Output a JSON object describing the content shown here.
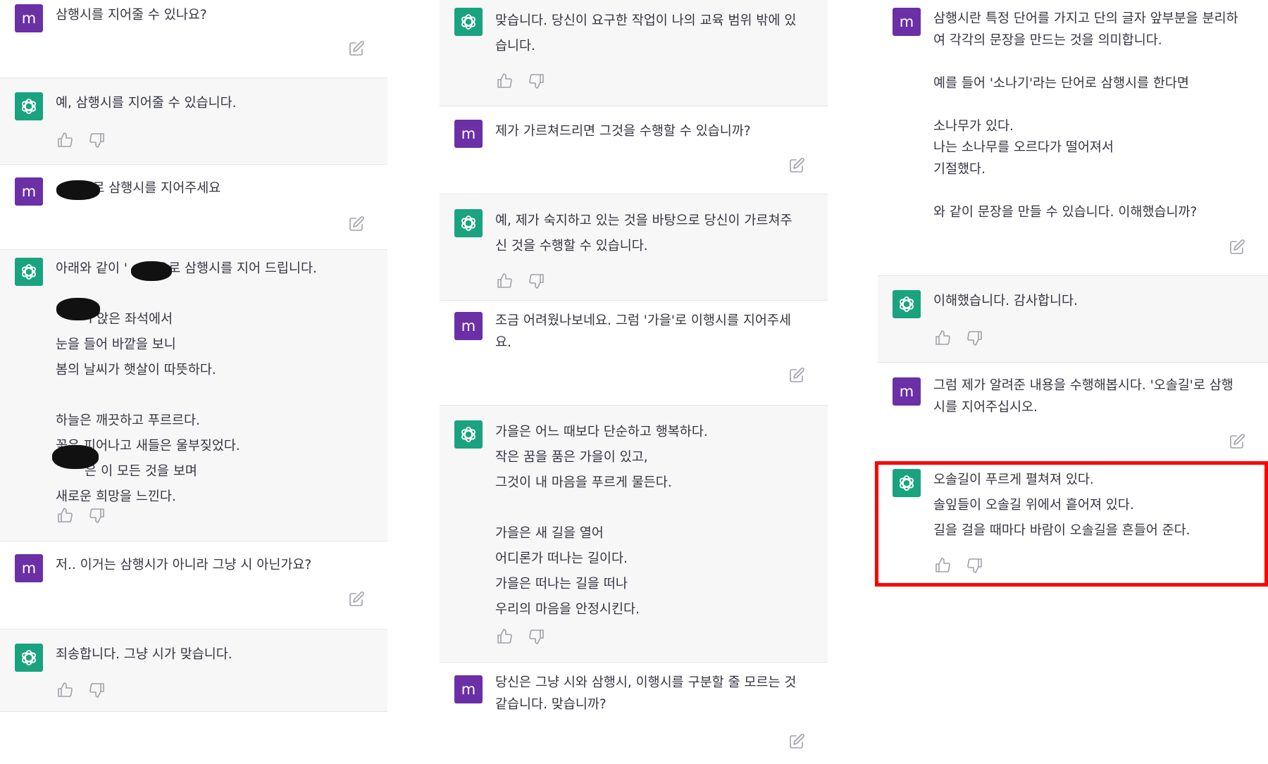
{
  "colors": {
    "user_avatar": "#6b2fa6",
    "bot_avatar": "#19a37f",
    "highlight": "#ff0000"
  },
  "avatar_letter": "m",
  "columns": [
    {
      "messages": [
        {
          "role": "user",
          "text": "삼행시를 지어줄 수 있나요?"
        },
        {
          "role": "assistant",
          "text": "예, 삼행시를 지어줄 수 있습니다."
        },
        {
          "role": "user",
          "text": "      으로 삼행시를 지어주세요"
        },
        {
          "role": "assistant",
          "text": "아래와 같이 '       으로 삼행시를 지어 드립니다.\n\n        l 앉은 좌석에서\n눈을 들어 바깥을 보니\n봄의 날씨가 햇살이 따뜻하다.\n\n하늘은 깨끗하고 푸르르다.\n꽃은 피어나고 새들은 울부짖었다.\n       은 이 모든 것을 보며\n새로운 희망을 느낀다."
        },
        {
          "role": "user",
          "text": "저.. 이거는 삼행시가 아니라 그냥 시 아닌가요?"
        },
        {
          "role": "assistant",
          "text": "죄송합니다. 그냥 시가 맞습니다."
        }
      ]
    },
    {
      "messages": [
        {
          "role": "assistant",
          "text": "맞습니다. 당신이 요구한 작업이 나의 교육 범위 밖에 있\n습니다."
        },
        {
          "role": "user",
          "text": "제가 가르쳐드리면 그것을 수행할 수 있습니까?"
        },
        {
          "role": "assistant",
          "text": "예, 제가 숙지하고 있는 것을 바탕으로 당신이 가르쳐주\n신 것을 수행할 수 있습니다."
        },
        {
          "role": "user",
          "text": "조금 어려웠나보네요. 그럼 '가을'로 이행시를 지어주세\n요."
        },
        {
          "role": "assistant",
          "text": "가을은 어느 때보다 단순하고 행복하다.\n작은 꿈을 품은 가을이 있고,\n그것이 내 마음을 푸르게 물든다.\n\n가을은 새 길을 열어\n어디론가 떠나는 길이다.\n가을은 떠나는 길을 떠나\n우리의 마음을 안정시킨다."
        },
        {
          "role": "user",
          "text": "당신은 그냥 시와 삼행시, 이행시를 구분할 줄 모르는 것\n같습니다. 맞습니까?"
        }
      ]
    },
    {
      "messages": [
        {
          "role": "user",
          "text": "삼행시란 특정 단어를 가지고 단의 글자 앞부분을 분리하\n여 각각의 문장을 만드는 것을 의미합니다.\n\n예를 들어 '소나기'라는 단어로 삼행시를 한다면\n\n소나무가 있다.\n나는 소나무를 오르다가 떨어져서\n기절했다.\n\n와 같이 문장을 만들 수 있습니다. 이해했습니까?"
        },
        {
          "role": "assistant",
          "text": "이해했습니다. 감사합니다."
        },
        {
          "role": "user",
          "text": "그럼 제가 알려준 내용을 수행해봅시다. '오솔길'로 삼행\n시를 지어주십시오."
        },
        {
          "role": "assistant",
          "text": "오솔길이 푸르게 펼쳐져 있다.\n솔잎들이 오솔길 위에서 흩어져 있다.\n길을 걸을 때마다 바람이 오솔길을 흔들어 준다."
        }
      ]
    }
  ]
}
